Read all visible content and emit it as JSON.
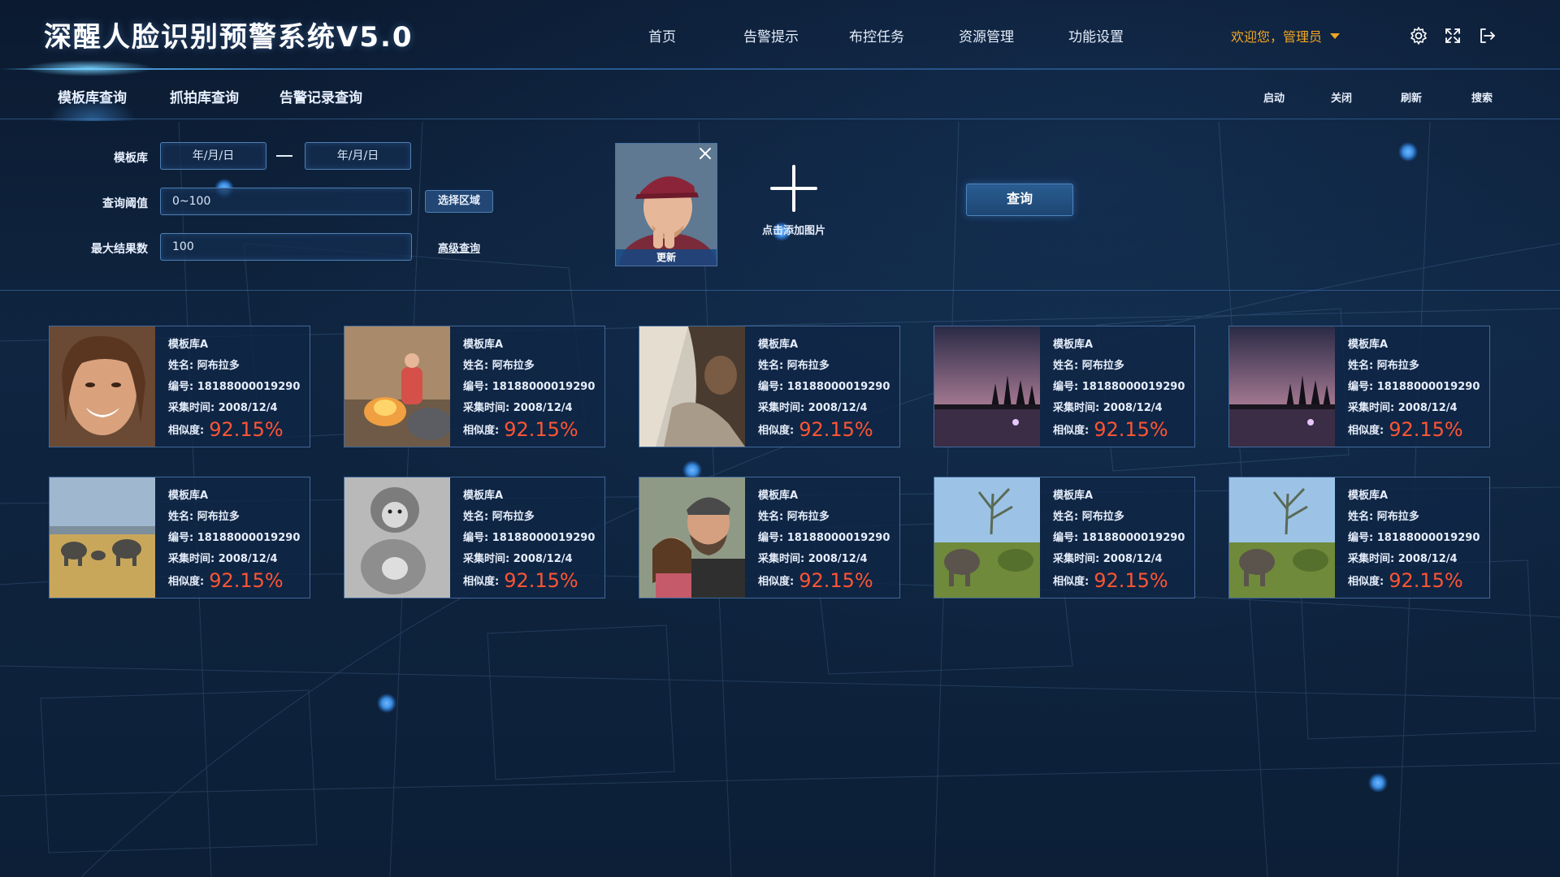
{
  "header": {
    "title": "深醒人脸识别预警系统V5.0",
    "nav": [
      "首页",
      "告警提示",
      "布控任务",
      "资源管理",
      "功能设置"
    ],
    "user_greeting": "欢迎您，管理员",
    "icons": [
      "gear-icon",
      "fullscreen-icon",
      "logout-icon"
    ]
  },
  "subnav": {
    "tabs": [
      "模板库查询",
      "抓拍库查询",
      "告警记录查询"
    ],
    "active_tab": "模板库查询",
    "actions": [
      "启动",
      "关闭",
      "刷新",
      "搜索"
    ]
  },
  "search": {
    "template_label": "模板库",
    "date_from": "年/月/日",
    "date_to": "年/月/日",
    "threshold_label": "查询阈值",
    "threshold_value": "0~100",
    "select_area_label": "选择区域",
    "max_results_label": "最大结果数",
    "max_results_value": "100",
    "advanced_label": "高级查询",
    "upload_caption": "更新",
    "add_image_label": "点击添加图片",
    "query_label": "查询"
  },
  "results": [
    {
      "library": "模板库A",
      "name": "姓名: 阿布拉多",
      "id": "编号: 18188000019290",
      "time": "采集时间: 2008/12/4",
      "sim_label": "相似度:",
      "similarity": "92.15%"
    },
    {
      "library": "模板库A",
      "name": "姓名: 阿布拉多",
      "id": "编号: 18188000019290",
      "time": "采集时间: 2008/12/4",
      "sim_label": "相似度:",
      "similarity": "92.15%"
    },
    {
      "library": "模板库A",
      "name": "姓名: 阿布拉多",
      "id": "编号: 18188000019290",
      "time": "采集时间: 2008/12/4",
      "sim_label": "相似度:",
      "similarity": "92.15%"
    },
    {
      "library": "模板库A",
      "name": "姓名: 阿布拉多",
      "id": "编号: 18188000019290",
      "time": "采集时间: 2008/12/4",
      "sim_label": "相似度:",
      "similarity": "92.15%"
    },
    {
      "library": "模板库A",
      "name": "姓名: 阿布拉多",
      "id": "编号: 18188000019290",
      "time": "采集时间: 2008/12/4",
      "sim_label": "相似度:",
      "similarity": "92.15%"
    },
    {
      "library": "模板库A",
      "name": "姓名: 阿布拉多",
      "id": "编号: 18188000019290",
      "time": "采集时间: 2008/12/4",
      "sim_label": "相似度:",
      "similarity": "92.15%"
    },
    {
      "library": "模板库A",
      "name": "姓名: 阿布拉多",
      "id": "编号: 18188000019290",
      "time": "采集时间: 2008/12/4",
      "sim_label": "相似度:",
      "similarity": "92.15%"
    },
    {
      "library": "模板库A",
      "name": "姓名: 阿布拉多",
      "id": "编号: 18188000019290",
      "time": "采集时间: 2008/12/4",
      "sim_label": "相似度:",
      "similarity": "92.15%"
    },
    {
      "library": "模板库A",
      "name": "姓名: 阿布拉多",
      "id": "编号: 18188000019290",
      "time": "采集时间: 2008/12/4",
      "sim_label": "相似度:",
      "similarity": "92.15%"
    },
    {
      "library": "模板库A",
      "name": "姓名: 阿布拉多",
      "id": "编号: 18188000019290",
      "time": "采集时间: 2008/12/4",
      "sim_label": "相似度:",
      "similarity": "92.15%"
    }
  ],
  "colors": {
    "accent_orange": "#f5a623",
    "similarity_red": "#ff5533",
    "border_blue": "#4f7fb3"
  }
}
